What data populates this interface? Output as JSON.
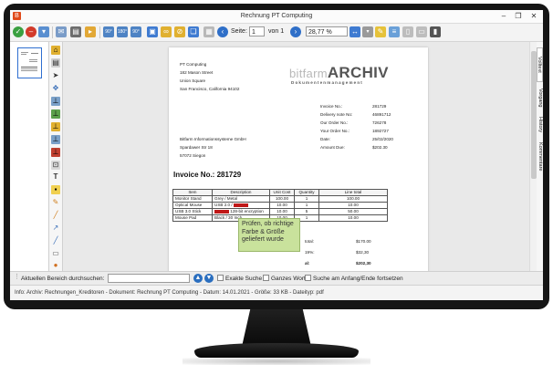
{
  "window": {
    "app_icon": "B",
    "title": "Rechnung PT Computing",
    "minimize": "–",
    "restore": "❐",
    "close": "✕"
  },
  "toolbar": {
    "rotate_labels": [
      "90°",
      "180°",
      "90°"
    ],
    "page_label": "Seite:",
    "page_value": "1",
    "page_of": "von 1",
    "zoom_value": "28,77 %"
  },
  "document": {
    "sender": [
      "PT Computing",
      "182 Mason Street",
      "Union Square",
      "San Francisco, California 94102"
    ],
    "logo_prefix": "bitfarm",
    "logo_main": "ARCHIV",
    "logo_sub": "Dokumentenmanagement",
    "meta": [
      {
        "label": "Invoice No.:",
        "value": "281729"
      },
      {
        "label": "Delivery note No:",
        "value": "46891712"
      },
      {
        "label": "Our Order No.:",
        "value": "726278"
      },
      {
        "label": "Your Order No.:",
        "value": "1892727"
      },
      {
        "label": "Date:",
        "value": "25/02/2020"
      },
      {
        "label": "Amount Due:",
        "value": "$202.30"
      }
    ],
    "recipient": [
      "Bitfarm Informationssysteme GmbH",
      "Spardawer Str 18",
      "57072 Siegon"
    ],
    "invoice_title": "Invoice No.: 281729",
    "table_headers": [
      "Item",
      "Description",
      "Unit Cost",
      "Quantity",
      "Line total"
    ],
    "table_rows": [
      {
        "item": "Monitor Stand",
        "desc": "Grey / Metal",
        "redact": false,
        "cost": "100.00",
        "qty": "1",
        "total": "100.00"
      },
      {
        "item": "Optical Mouse",
        "desc": "USB 2.0 /",
        "redact": true,
        "cost": "10.00",
        "qty": "1",
        "total": "10.00"
      },
      {
        "item": "USB 3.0 Stick",
        "desc": "128-bit encryption",
        "redact": true,
        "cost": "10.00",
        "qty": "5",
        "total": "50.00"
      },
      {
        "item": "Mouse Pad",
        "desc": "Black / 30 Inch",
        "redact": false,
        "cost": "10.00",
        "qty": "1",
        "total": "10.00"
      }
    ],
    "totals": [
      {
        "label": "total:",
        "value": "$170.00"
      },
      {
        "label": "19%:",
        "value": "$32,30"
      },
      {
        "label": "al:",
        "value": "$202,30"
      }
    ],
    "note": "Prüfen, ob richtige Farbe & Größe geliefert wurde"
  },
  "sidetabs": [
    "Volltext",
    "Vorgang",
    "History",
    "Kommentare"
  ],
  "findbar": {
    "label": "Aktuellen Bereich durchsuchen:",
    "search_value": "",
    "options": [
      "Exakte Suche",
      "Ganzes Wort",
      "Suche am Anfang/Ende fortsetzen"
    ]
  },
  "status": "Info:  Archiv: Rechnungen_Kreditoren - Dokument: Rechnung PT Computing - Datum: 14.01.2021 - Größe: 33 KB - Dateityp: pdf"
}
